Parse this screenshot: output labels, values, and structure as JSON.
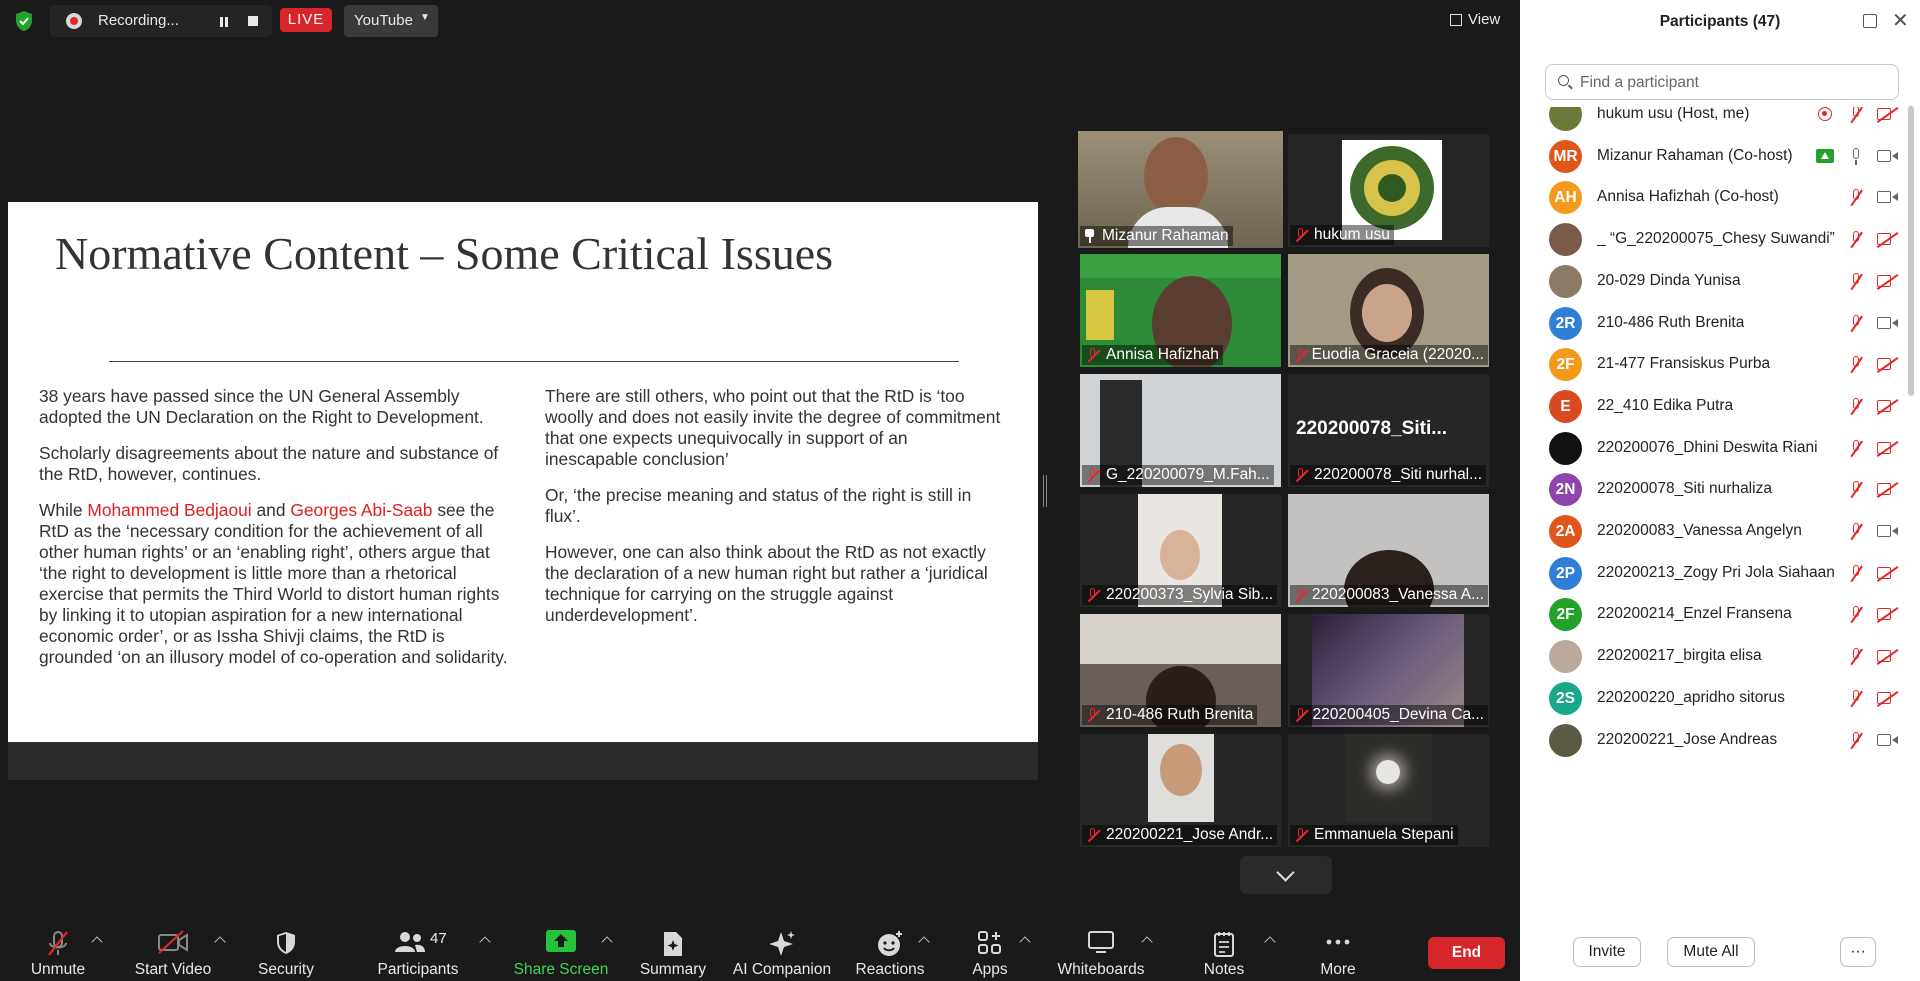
{
  "topbar": {
    "recording_label": "Recording...",
    "live_label": "LIVE",
    "stream_target": "YouTube",
    "view_label": "View"
  },
  "slide": {
    "title": "Normative Content – Some Critical Issues",
    "col1": {
      "p1": "38 years have passed since the UN General Assembly adopted the UN Declaration on the Right to Development.",
      "p2": "Scholarly disagreements about the nature and substance of the RtD, however, continues.",
      "p3_pre": "While ",
      "p3_name1": "Mohammed Bedjaoui",
      "p3_and": " and ",
      "p3_name2": "Georges Abi-Saab",
      "p3_post": " see the RtD as the ‘necessary condition for the achievement of all other human rights’ or an ‘enabling right’, others argue that ‘the right to development is little more than a rhetorical exercise that permits the Third World to distort human rights by linking it to utopian aspiration for a new international economic order’, or as Issha Shivji claims, the RtD is grounded ‘on an illusory model of co-operation and solidarity."
    },
    "col2": {
      "p1": "There are still others, who point out that the RtD is ‘too woolly and does not easily invite the degree of commitment that one expects unequivocally in support of an inescapable conclusion’",
      "p2": "Or, ‘the precise meaning and status of the right is still in flux’.",
      "p3": "However, one can also think about the RtD as not exactly the declaration of a new human right but rather a ‘juridical technique for carrying on the struggle against underdevelopment’."
    }
  },
  "tiles": [
    {
      "name": "Mizanur Rahaman"
    },
    {
      "name": "hukum usu"
    },
    {
      "name": "Annisa Hafizhah"
    },
    {
      "name": "Euodia Graceia (22020..."
    },
    {
      "name": "G_220200079_M.Fah..."
    },
    {
      "name": "220200078_Siti nurhal...",
      "big_name": "220200078_Siti..."
    },
    {
      "name": "220200373_Sylvia Sib..."
    },
    {
      "name": "220200083_Vanessa A..."
    },
    {
      "name": "210-486 Ruth Brenita"
    },
    {
      "name": "220200405_Devina Ca..."
    },
    {
      "name": "220200221_Jose Andr..."
    },
    {
      "name": "Emmanuela Stepani"
    }
  ],
  "toolbar": {
    "unmute": "Unmute",
    "start_video": "Start Video",
    "security": "Security",
    "participants": "Participants",
    "participants_count": "47",
    "share_screen": "Share Screen",
    "summary": "Summary",
    "ai_companion": "AI Companion",
    "reactions": "Reactions",
    "apps": "Apps",
    "whiteboards": "Whiteboards",
    "notes": "Notes",
    "more": "More",
    "end": "End"
  },
  "panel": {
    "title": "Participants (47)",
    "search_placeholder": "Find a participant",
    "invite": "Invite",
    "mute_all": "Mute All",
    "more": "···",
    "participants": [
      {
        "initials": "",
        "color": "#6b7a3a",
        "name": "hukum usu (Host, me)"
      },
      {
        "initials": "MR",
        "color": "#e0551b",
        "name": "Mizanur Rahaman (Co-host)"
      },
      {
        "initials": "AH",
        "color": "#f39a1d",
        "name": "Annisa Hafizhah (Co-host)"
      },
      {
        "initials": "",
        "color": "#7a5a48",
        "name": "_ “G_220200075_Chesy Suwandi”"
      },
      {
        "initials": "",
        "color": "#8a7a66",
        "name": "20-029 Dinda Yunisa"
      },
      {
        "initials": "2R",
        "color": "#2f7fd6",
        "name": "210-486 Ruth Brenita"
      },
      {
        "initials": "2F",
        "color": "#f39a1d",
        "name": "21-477 Fransiskus Purba"
      },
      {
        "initials": "E",
        "color": "#d84a1f",
        "name": "22_410 Edika Putra"
      },
      {
        "initials": "",
        "color": "#111111",
        "name": "220200076_Dhini Deswita Riani"
      },
      {
        "initials": "2N",
        "color": "#8e44ad",
        "name": "220200078_Siti nurhaliza"
      },
      {
        "initials": "2A",
        "color": "#e0551b",
        "name": "220200083_Vanessa Angelyn"
      },
      {
        "initials": "2P",
        "color": "#2f7fd6",
        "name": "220200213_Zogy Pri Jola Siahaan"
      },
      {
        "initials": "2F",
        "color": "#23a12b",
        "name": "220200214_Enzel Fransena"
      },
      {
        "initials": "",
        "color": "#b9a99b",
        "name": "220200217_birgita elisa"
      },
      {
        "initials": "2S",
        "color": "#1aa88a",
        "name": "220200220_apridho sitorus"
      },
      {
        "initials": "",
        "color": "#5b5a44",
        "name": "220200221_Jose Andreas"
      }
    ]
  }
}
